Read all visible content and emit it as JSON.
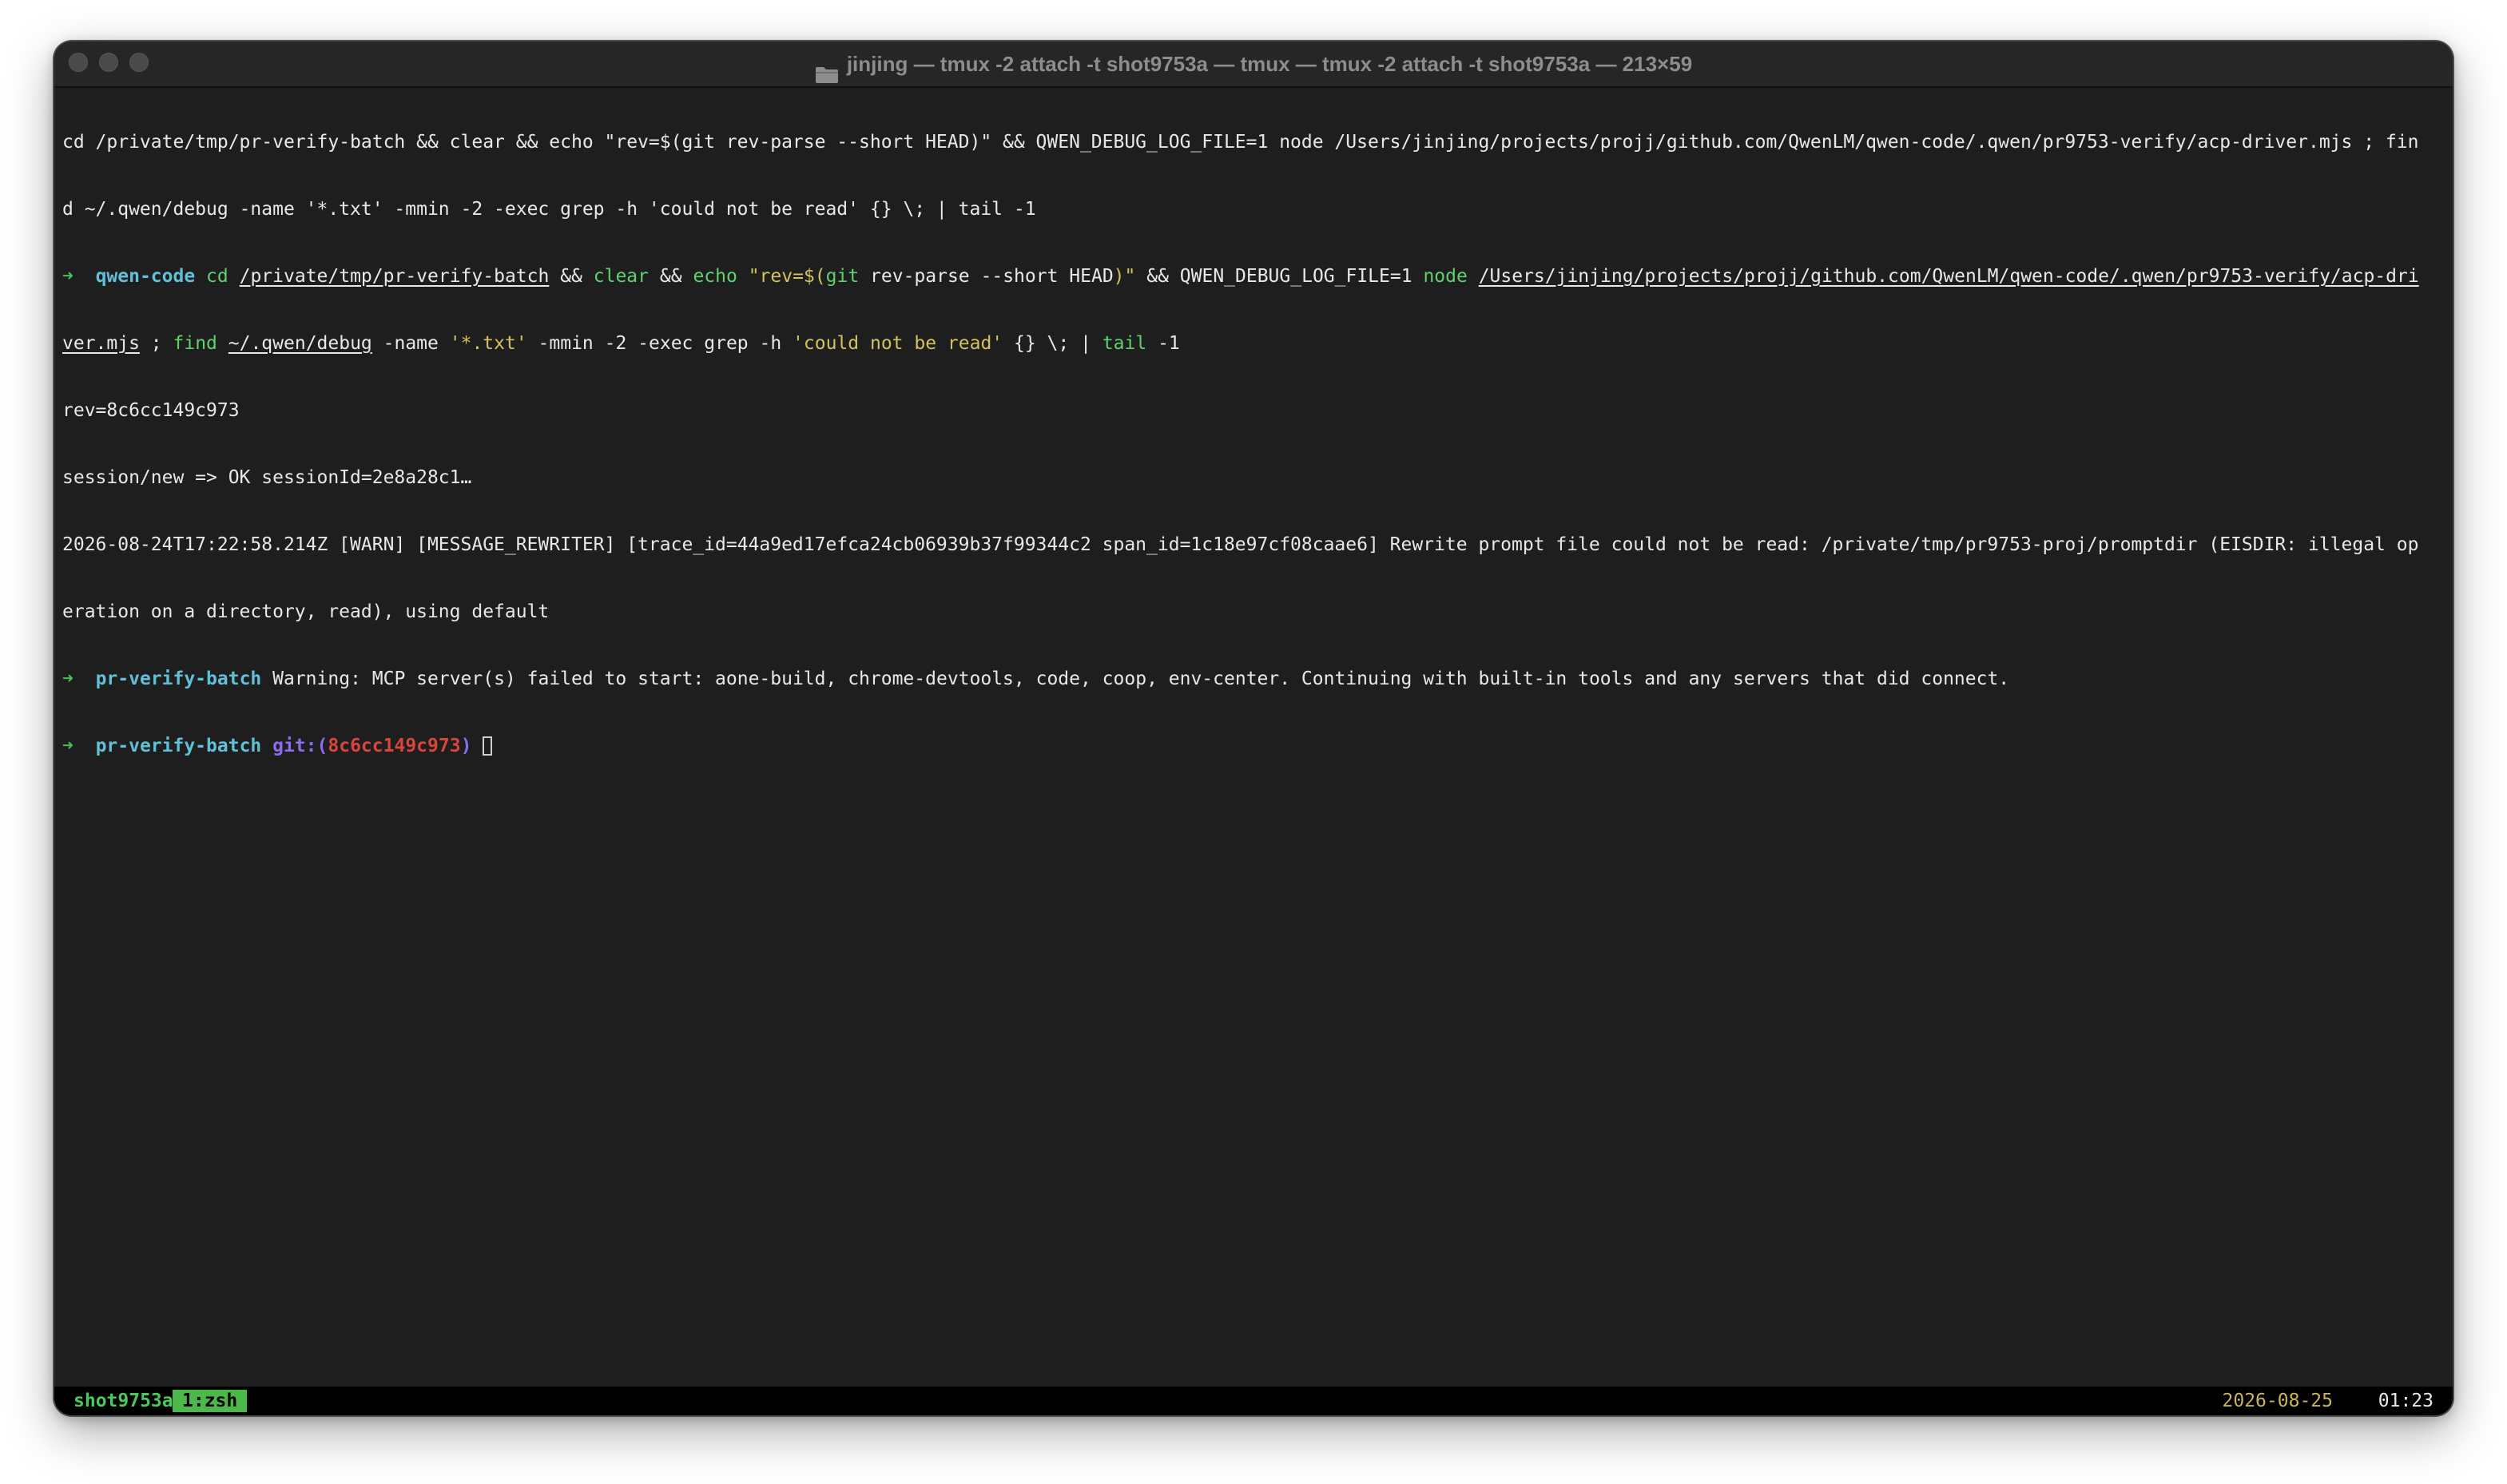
{
  "window": {
    "title": "jinjing — tmux -2 attach -t shot9753a — tmux — tmux -2 attach -t shot9753a — 213×59"
  },
  "terminal": {
    "line1": "cd /private/tmp/pr-verify-batch && clear && echo \"rev=$(git rev-parse --short HEAD)\" && QWEN_DEBUG_LOG_FILE=1 node /Users/jinjing/projects/projj/github.com/QwenLM/qwen-code/.qwen/pr9753-verify/acp-driver.mjs ; fin",
    "line2": "d ~/.qwen/debug -name '*.txt' -mmin -2 -exec grep -h 'could not be read' {} \\; | tail -1",
    "prompt1": {
      "arrow": "➜",
      "dir": "qwen-code",
      "cmd_cd": "cd",
      "path1": "/private/tmp/pr-verify-batch",
      "and1": "&&",
      "cmd_clear": "clear",
      "and2": "&&",
      "cmd_echo": "echo",
      "str_open": "\"rev=$(",
      "cmd_git": "git",
      "git_args": "rev-parse --short HEAD",
      "str_close": ")\"",
      "env": "&& QWEN_DEBUG_LOG_FILE=1",
      "cmd_node": "node",
      "path2a": "/Users/jinjing/projects/projj/github.com/QwenLM/qwen-code/.qwen/pr9753-verify/acp-dri",
      "path2b": "ver.mjs",
      "semi": ";",
      "cmd_find": "find",
      "path3": "~/.qwen/debug",
      "find_args1": "-name",
      "str_txt": "'*.txt'",
      "find_args2": "-mmin -2 -exec grep -h",
      "str_grep": "'could not be read'",
      "find_args3": "{} \\; |",
      "cmd_tail": "tail",
      "tail_args": "-1"
    },
    "out_rev": "rev=8c6cc149c973",
    "out_session": "session/new => OK sessionId=2e8a28c1…",
    "out_warn1": "2026-08-24T17:22:58.214Z [WARN] [MESSAGE_REWRITER] [trace_id=44a9ed17efca24cb06939b37f99344c2 span_id=1c18e97cf08caae6] Rewrite prompt file could not be read: /private/tmp/pr9753-proj/promptdir (EISDIR: illegal op",
    "out_warn2": "eration on a directory, read), using default",
    "prompt2": {
      "arrow": "➜",
      "dir": "pr-verify-batch",
      "text": "Warning: MCP server(s) failed to start: aone-build, chrome-devtools, code, coop, env-center. Continuing with built-in tools and any servers that did connect."
    },
    "prompt3": {
      "arrow": "➜",
      "dir": "pr-verify-batch",
      "git_label": "git:(",
      "hash": "8c6cc149c973",
      "git_close": ")"
    }
  },
  "statusbar": {
    "session": "shot9753a",
    "window": "1:zsh",
    "date": "2026-08-25",
    "time": "01:23"
  },
  "icons": [
    "folder-icon",
    "close-icon",
    "minimize-icon",
    "zoom-icon",
    "cursor"
  ],
  "colors": {
    "background": "#1e1e1e",
    "prompt_arrow": "#48c05a",
    "directory": "#5fc0d8",
    "git_label": "#8a6cf0",
    "git_hash": "#d8453a",
    "command": "#5fd16e",
    "string": "#d4c25c",
    "status_session": "#4cc75a",
    "status_window_bg": "#4cb84a",
    "status_date": "#c9b458"
  }
}
